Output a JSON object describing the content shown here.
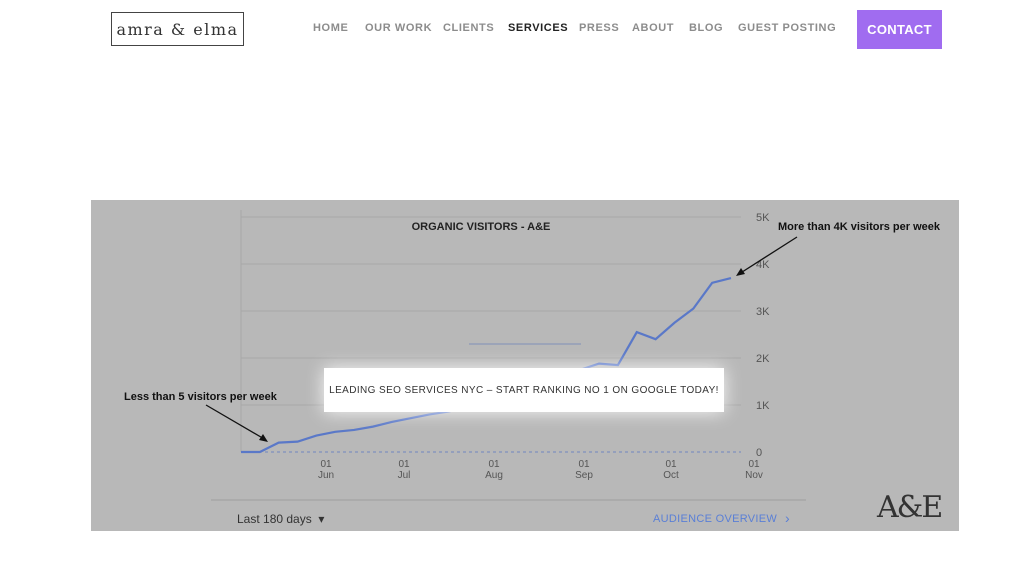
{
  "header": {
    "logo_text": "amra & elma",
    "nav": [
      {
        "label": "HOME",
        "active": false
      },
      {
        "label": "OUR WORK",
        "active": false
      },
      {
        "label": "CLIENTS",
        "active": false
      },
      {
        "label": "SERVICES",
        "active": true
      },
      {
        "label": "PRESS",
        "active": false
      },
      {
        "label": "ABOUT",
        "active": false
      },
      {
        "label": "BLOG",
        "active": false
      },
      {
        "label": "GUEST POSTING",
        "active": false
      }
    ],
    "contact_label": "CONTACT",
    "contact_color": "#a06cf0"
  },
  "hero": {
    "overlay_text": "LEADING SEO SERVICES NYC – START RANKING NO 1 ON GOOGLE TODAY!",
    "range_label": "Last 180 days",
    "audience_link": "AUDIENCE OVERVIEW",
    "brand_mark": "A&E",
    "annotation_low": "Less than 5 visitors per week",
    "annotation_high": "More than 4K visitors per week"
  },
  "chart_data": {
    "type": "line",
    "title": "ORGANIC VISITORS - A&E",
    "y_ticks": [
      "5K",
      "4K",
      "3K",
      "2K",
      "1K",
      "0"
    ],
    "ylim": [
      0,
      5000
    ],
    "x_ticks": [
      {
        "day": "01",
        "month": "Jun"
      },
      {
        "day": "01",
        "month": "Jul"
      },
      {
        "day": "01",
        "month": "Aug"
      },
      {
        "day": "01",
        "month": "Sep"
      },
      {
        "day": "01",
        "month": "Oct"
      },
      {
        "day": "01",
        "month": "Nov"
      }
    ],
    "line_color": "#5a78c8",
    "series": [
      {
        "values": [
          0,
          0,
          200,
          220,
          350,
          430,
          470,
          540,
          640,
          720,
          800,
          860,
          950,
          1050,
          1150,
          1300,
          1450,
          1600,
          1750,
          1880,
          1850,
          2550,
          2400,
          2750,
          3050,
          3600,
          3700
        ]
      }
    ]
  }
}
